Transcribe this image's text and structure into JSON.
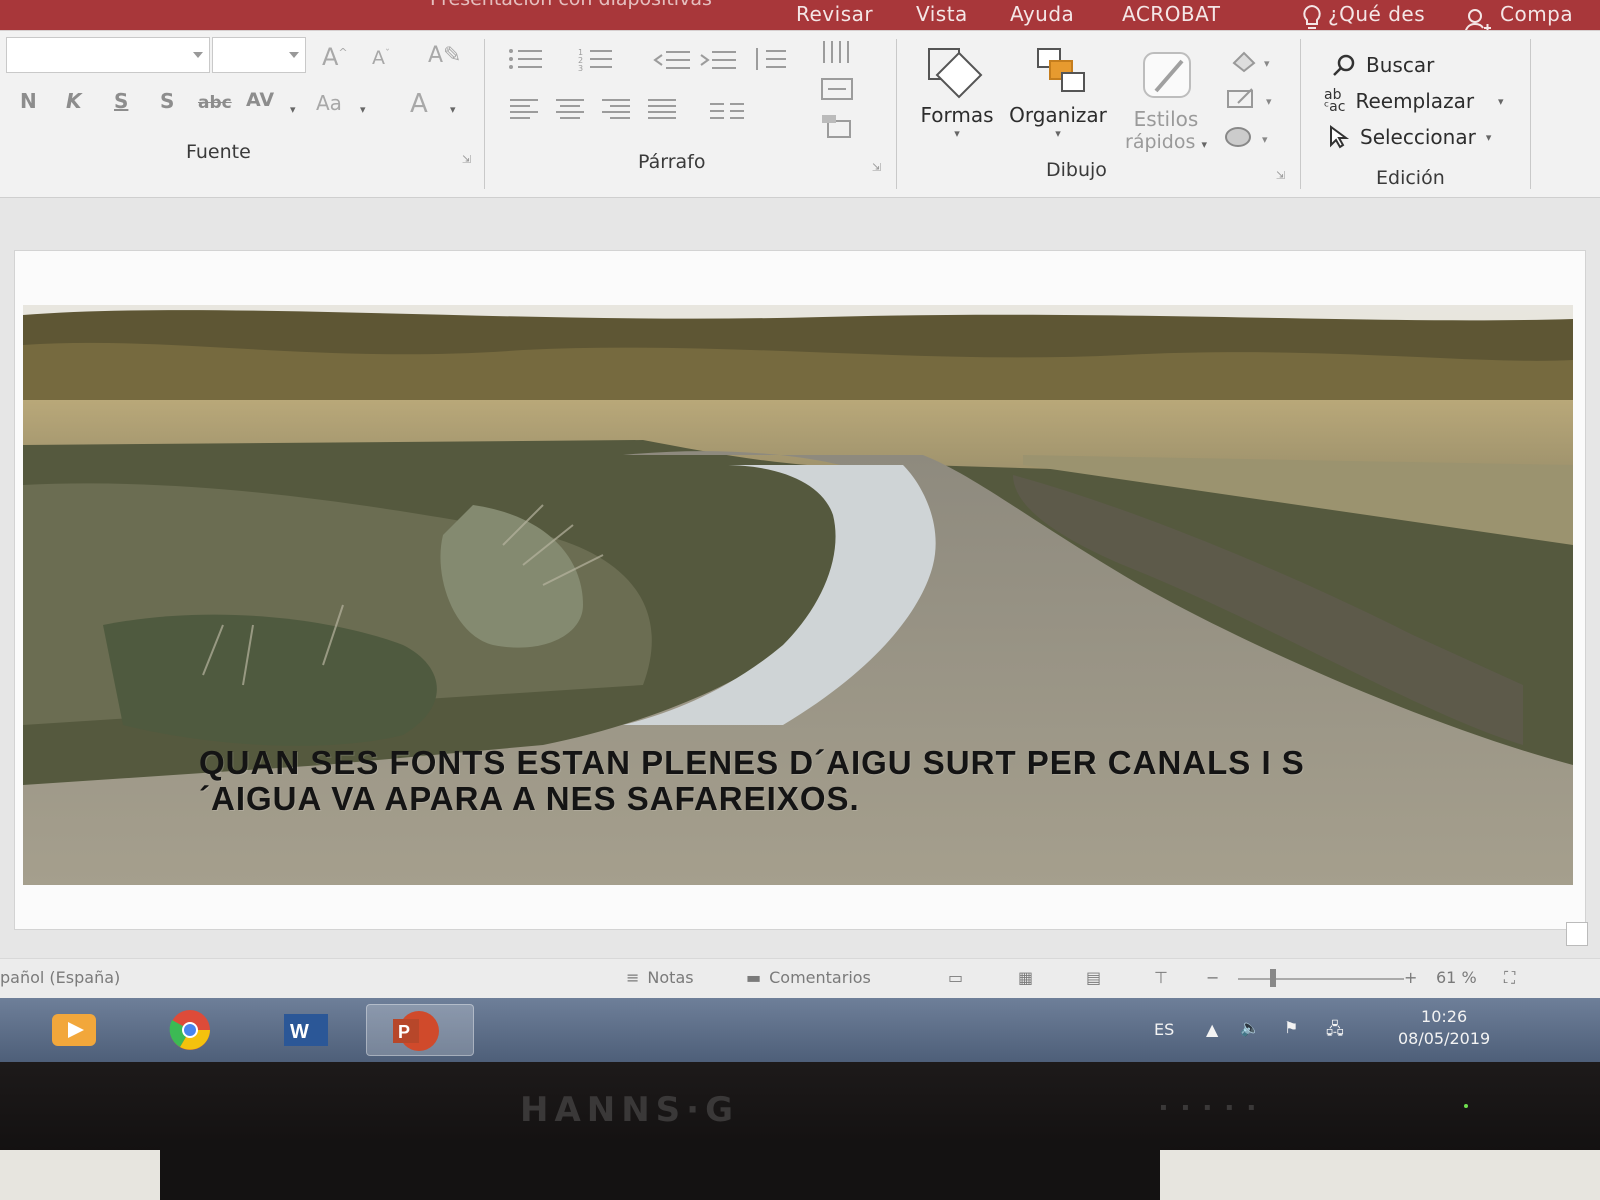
{
  "app": {
    "window_title_partial": "Presentación con diapositivas",
    "tabs": [
      "Revisar",
      "Vista",
      "Ayuda",
      "ACROBAT"
    ],
    "tell_me": "¿Qué des",
    "share": "Compa"
  },
  "ribbon": {
    "font_group": {
      "label": "Fuente",
      "font_name": "",
      "font_size": "",
      "bold": "N",
      "italic": "K",
      "underline": "S",
      "shadow": "S",
      "strike": "abc",
      "spacing": "AV",
      "case": "Aa",
      "color": "A"
    },
    "paragraph_group": {
      "label": "Párrafo"
    },
    "drawing_group": {
      "label": "Dibujo",
      "shapes": "Formas",
      "arrange": "Organizar",
      "quick_styles_line1": "Estilos",
      "quick_styles_line2": "rápidos"
    },
    "editing_group": {
      "label": "Edición",
      "find": "Buscar",
      "replace": "Reemplazar",
      "select": "Seleccionar"
    }
  },
  "slide": {
    "caption": "QUAN SES FONTS ESTAN PLENES D´AIGU SURT PER CANALS I S´AIGUA VA APARA A NES SAFAREIXOS.",
    "image_icon": "landscape-photo-icon"
  },
  "statusbar": {
    "language": "pañol (España)",
    "notes": "Notas",
    "comments": "Comentarios",
    "zoom": "61 %"
  },
  "taskbar": {
    "input_lang": "ES",
    "time": "10:26",
    "date": "08/05/2019"
  },
  "monitor": {
    "brand": "HANNS·G"
  },
  "colors": {
    "ribbon_accent": "#a8373a",
    "ribbon_bg": "#f2f2f2",
    "taskbar": "#5a6b85"
  }
}
